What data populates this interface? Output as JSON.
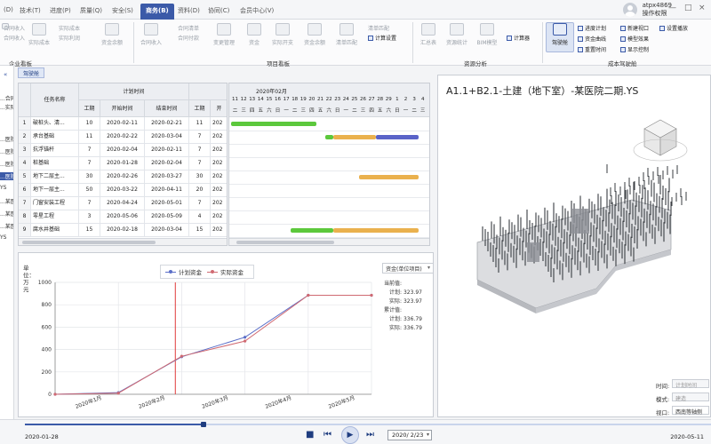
{
  "menu": {
    "items": [
      "(D)",
      "技术(T)",
      "进度(P)",
      "质量(Q)",
      "安全(S)",
      "商务(B)",
      "资料(D)",
      "协同(C)",
      "会员中心(V)"
    ],
    "active_index": 5
  },
  "user": {
    "name": "atpx4869",
    "role": "操作权限"
  },
  "window": {
    "minimize": "—",
    "restore": "□",
    "close": "×"
  },
  "ribbon": {
    "groups": [
      "企业看板",
      "项目看板",
      "资源分析",
      "成本驾驶舱"
    ],
    "enterprise": {
      "items": [
        "合同收入",
        "合同收入",
        "实际成本",
        "实际成本",
        "实际利润",
        "资金余额"
      ]
    },
    "project": {
      "items": [
        "合同收入",
        "合同清单",
        "合同付款",
        "变更管理",
        "资金",
        "实际开支",
        "资金余额",
        "清单匹配",
        "清单匹配",
        "计算设置"
      ]
    },
    "resource": {
      "items": [
        "汇总表",
        "资源统计",
        "BIM模型",
        "计算器"
      ]
    },
    "cost": {
      "big": "驾驶舱",
      "items": [
        "进度计划",
        "资金曲线",
        "重置时间",
        "新建视口",
        "模型效果",
        "显示控制",
        "设置播放"
      ]
    }
  },
  "leftnav": {
    "items": [
      "...合同收入",
      "...实际成本",
      "...医院",
      "...医院",
      "...医院",
      "...医院",
      "YS",
      "...某医院",
      "...某医院",
      "...某医院",
      "YS"
    ]
  },
  "doctab": {
    "label": "驾驶舱"
  },
  "grid": {
    "headers": {
      "name": "任务名称",
      "plan": "计划时间",
      "dur": "工期",
      "start": "开始时间",
      "end": "结束时间",
      "dur2": "工期",
      "actual": "开"
    },
    "rows": [
      {
        "id": "1",
        "name": "破桩头、清...",
        "dur": "10",
        "start": "2020-02-11",
        "end": "2020-02-21",
        "dur2": "11",
        "act": "202"
      },
      {
        "id": "2",
        "name": "承台基础",
        "dur": "11",
        "start": "2020-02-22",
        "end": "2020-03-04",
        "dur2": "7",
        "act": "202"
      },
      {
        "id": "3",
        "name": "抗浮锚杆",
        "dur": "7",
        "start": "2020-02-04",
        "end": "2020-02-11",
        "dur2": "7",
        "act": "202"
      },
      {
        "id": "4",
        "name": "桩基础",
        "dur": "7",
        "start": "2020-01-28",
        "end": "2020-02-04",
        "dur2": "7",
        "act": "202"
      },
      {
        "id": "5",
        "name": "地下二层主...",
        "dur": "30",
        "start": "2020-02-26",
        "end": "2020-03-27",
        "dur2": "30",
        "act": "202"
      },
      {
        "id": "6",
        "name": "地下一层主...",
        "dur": "50",
        "start": "2020-03-22",
        "end": "2020-04-11",
        "dur2": "20",
        "act": "202"
      },
      {
        "id": "7",
        "name": "门窗安装工程",
        "dur": "7",
        "start": "2020-04-24",
        "end": "2020-05-01",
        "dur2": "7",
        "act": "202"
      },
      {
        "id": "8",
        "name": "零星工程",
        "dur": "3",
        "start": "2020-05-06",
        "end": "2020-05-09",
        "dur2": "4",
        "act": "202"
      },
      {
        "id": "9",
        "name": "腐水井基础",
        "dur": "15",
        "start": "2020-02-18",
        "end": "2020-03-04",
        "dur2": "15",
        "act": "202"
      }
    ]
  },
  "gantt": {
    "month": "2020年02月",
    "days": [
      "11",
      "12",
      "13",
      "14",
      "15",
      "16",
      "17",
      "18",
      "19",
      "20",
      "21",
      "22",
      "23",
      "24",
      "25",
      "26",
      "27",
      "28",
      "29",
      "1",
      "2",
      "3",
      "4"
    ],
    "weekdays": [
      "二",
      "三",
      "四",
      "五",
      "六",
      "日",
      "一",
      "二",
      "三",
      "四",
      "五",
      "六",
      "日",
      "一",
      "二",
      "三",
      "四",
      "五",
      "六",
      "日",
      "一",
      "二",
      "三"
    ],
    "colors": {
      "actual": "#5cc83c",
      "plan": "#eab14e",
      "remain": "#5a63c8"
    }
  },
  "chart_data": {
    "type": "line",
    "categories": [
      "2020年1月",
      "2020年2月",
      "2020年3月",
      "2020年4月",
      "2020年5月"
    ],
    "series": [
      {
        "name": "计划资金",
        "color": "#5b6fc8",
        "values": [
          0,
          15,
          335,
          510,
          885,
          885
        ]
      },
      {
        "name": "实际资金",
        "color": "#d06a72",
        "values": [
          0,
          10,
          340,
          475,
          885,
          885
        ]
      }
    ],
    "x_index": [
      0,
      1,
      2,
      3,
      4,
      5
    ],
    "ylabel": "单位：万元",
    "yticks": [
      0,
      200,
      400,
      600,
      800,
      1000
    ],
    "ylim": [
      0,
      1000
    ],
    "current_marker_index": 1.9,
    "grid": true,
    "legend": "top-center"
  },
  "chart_panel": {
    "select": "资金(单位项目)",
    "current_label": "当前值:",
    "cumulative_label": "累计值:",
    "plan_label": "计划:",
    "actual_label": "实际:",
    "current_plan": "323.97",
    "current_actual": "323.97",
    "cum_plan": "336.79",
    "cum_actual": "336.79"
  },
  "view3d": {
    "title": "A1.1+B2.1-土建（地下室）-某医院二期.YS",
    "time_label": "时间:",
    "time_value": "计划时间",
    "mode_label": "模式:",
    "mode_value": "建造",
    "view_label": "视口:",
    "view_value": "西南等轴侧"
  },
  "player": {
    "start_date": "2020-01-28",
    "end_date": "2020-05-11",
    "current": "2020/ 2/23",
    "progress": 0.26
  }
}
